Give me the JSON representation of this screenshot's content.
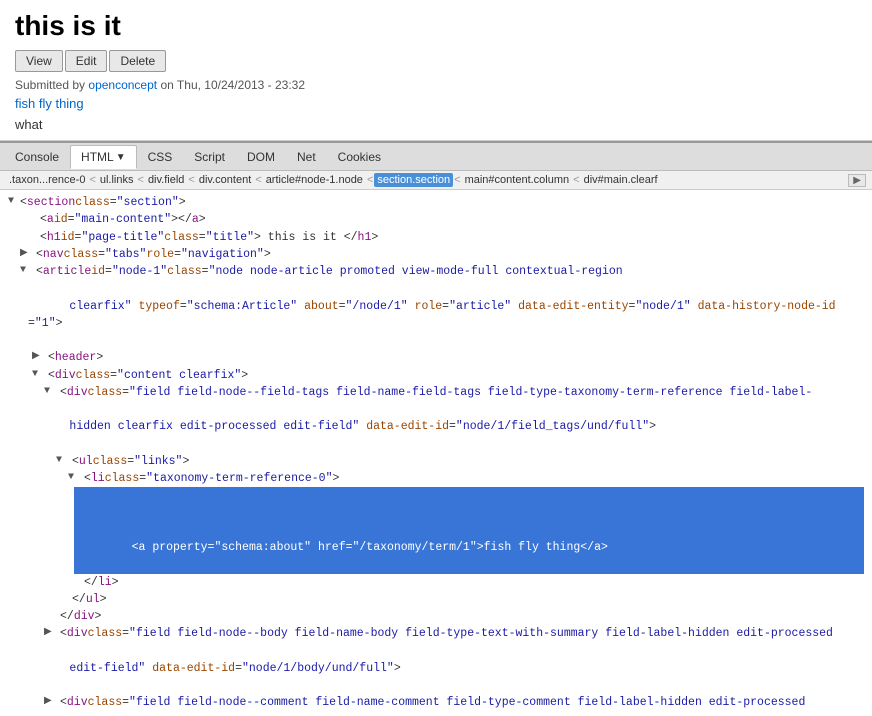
{
  "page": {
    "title": "this is it",
    "buttons": [
      "View",
      "Edit",
      "Delete"
    ],
    "submitted_text": "Submitted by",
    "author": "openconcept",
    "date": "on Thu, 10/24/2013 - 23:32",
    "tag_link": "fish fly thing",
    "what_text": "what"
  },
  "devtools": {
    "tabs": [
      "Console",
      "HTML",
      "CSS",
      "Script",
      "DOM",
      "Net",
      "Cookies"
    ],
    "active_tab": "HTML",
    "html_dropdown_label": "▼"
  },
  "breadcrumb": {
    "items": [
      ".taxon...rence-0",
      "ul.links",
      "div.field",
      "div.content",
      "article#node-1.node",
      "section.section",
      "main#content.column",
      "div#main.clearf▶"
    ],
    "active_item": "section.section"
  },
  "source": {
    "lines": []
  }
}
